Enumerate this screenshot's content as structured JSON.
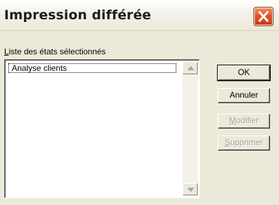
{
  "window": {
    "title": "Impression différée"
  },
  "list": {
    "label_accesskey": "L",
    "label_rest": "iste des états sélectionnés",
    "items": [
      "Analyse clients"
    ]
  },
  "buttons": {
    "ok": "OK",
    "cancel": "Annuler",
    "modify_accesskey": "M",
    "modify_rest": "odifier",
    "delete_accesskey": "S",
    "delete_rest": "upprimer"
  },
  "icons": {
    "close": "close-icon",
    "scroll_up": "scroll-up-arrow-icon",
    "scroll_down": "scroll-down-arrow-icon"
  }
}
